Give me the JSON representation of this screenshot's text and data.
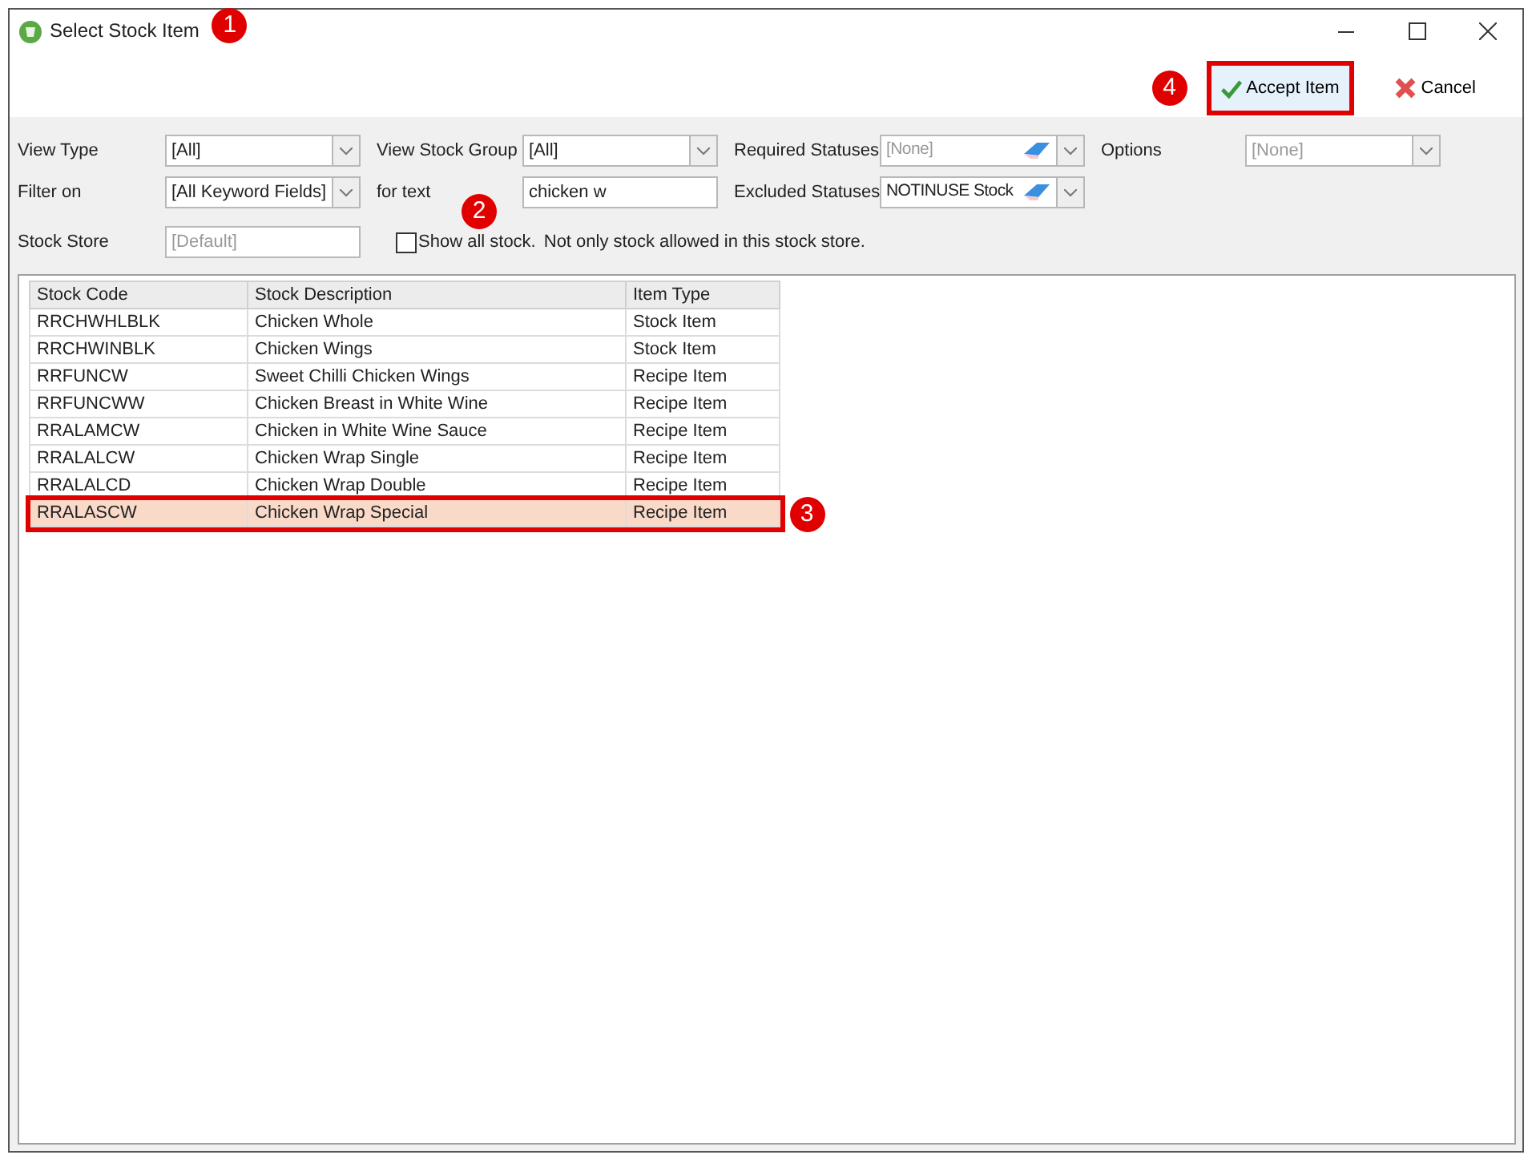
{
  "window": {
    "title": "Select Stock Item",
    "marker": "1"
  },
  "toolbar": {
    "buttons": [
      {
        "label": "Accept Item",
        "kind": "accept",
        "marker": "4"
      },
      {
        "label": "Cancel",
        "kind": "cancel"
      }
    ]
  },
  "filters": [
    {
      "label": "View Type",
      "kind": "combo",
      "value": "[All]",
      "disabled": false
    },
    {
      "label": "View Stock Group",
      "kind": "combo",
      "value": "[All]",
      "disabled": false
    },
    {
      "label": "Required Statuses",
      "kind": "lookup",
      "value": "[None]",
      "disabled": true
    },
    {
      "label": "Options",
      "kind": "combo",
      "value": "[None]",
      "disabled": true
    },
    {
      "label": "Filter on",
      "kind": "combo",
      "value": "[All Keyword Fields]",
      "disabled": false
    },
    {
      "label": "for text",
      "kind": "text",
      "value": "chicken w",
      "disabled": false,
      "marker": "2"
    },
    {
      "label": "Excluded Statuses",
      "kind": "lookup",
      "value": "NOTINUSE Stock",
      "disabled": false
    },
    {
      "label": "Stock Store",
      "kind": "text",
      "value": "[Default]",
      "disabled": true
    }
  ],
  "show_all": {
    "label": "Show all stock.",
    "checked": false,
    "note": "Not only stock allowed in this stock store."
  },
  "table": {
    "columns": [
      "Stock Code",
      "Stock Description",
      "Item Type"
    ],
    "rows": [
      {
        "cells": [
          "RRCHWHLBLK",
          "Chicken Whole",
          "Stock Item"
        ],
        "selected": false
      },
      {
        "cells": [
          "RRCHWINBLK",
          "Chicken Wings",
          "Stock Item"
        ],
        "selected": false
      },
      {
        "cells": [
          "RRFUNCW",
          "Sweet Chilli Chicken Wings",
          "Recipe Item"
        ],
        "selected": false
      },
      {
        "cells": [
          "RRFUNCWW",
          "Chicken Breast in White Wine",
          "Recipe Item"
        ],
        "selected": false
      },
      {
        "cells": [
          "RRALAMCW",
          "Chicken in White Wine Sauce",
          "Recipe Item"
        ],
        "selected": false
      },
      {
        "cells": [
          "RRALALCW",
          "Chicken Wrap Single",
          "Recipe Item"
        ],
        "selected": false
      },
      {
        "cells": [
          "RRALALCD",
          "Chicken Wrap Double",
          "Recipe Item"
        ],
        "selected": false
      },
      {
        "cells": [
          "RRALASCW",
          "Chicken Wrap Special",
          "Recipe Item"
        ],
        "selected": true,
        "marker": "3"
      }
    ]
  }
}
